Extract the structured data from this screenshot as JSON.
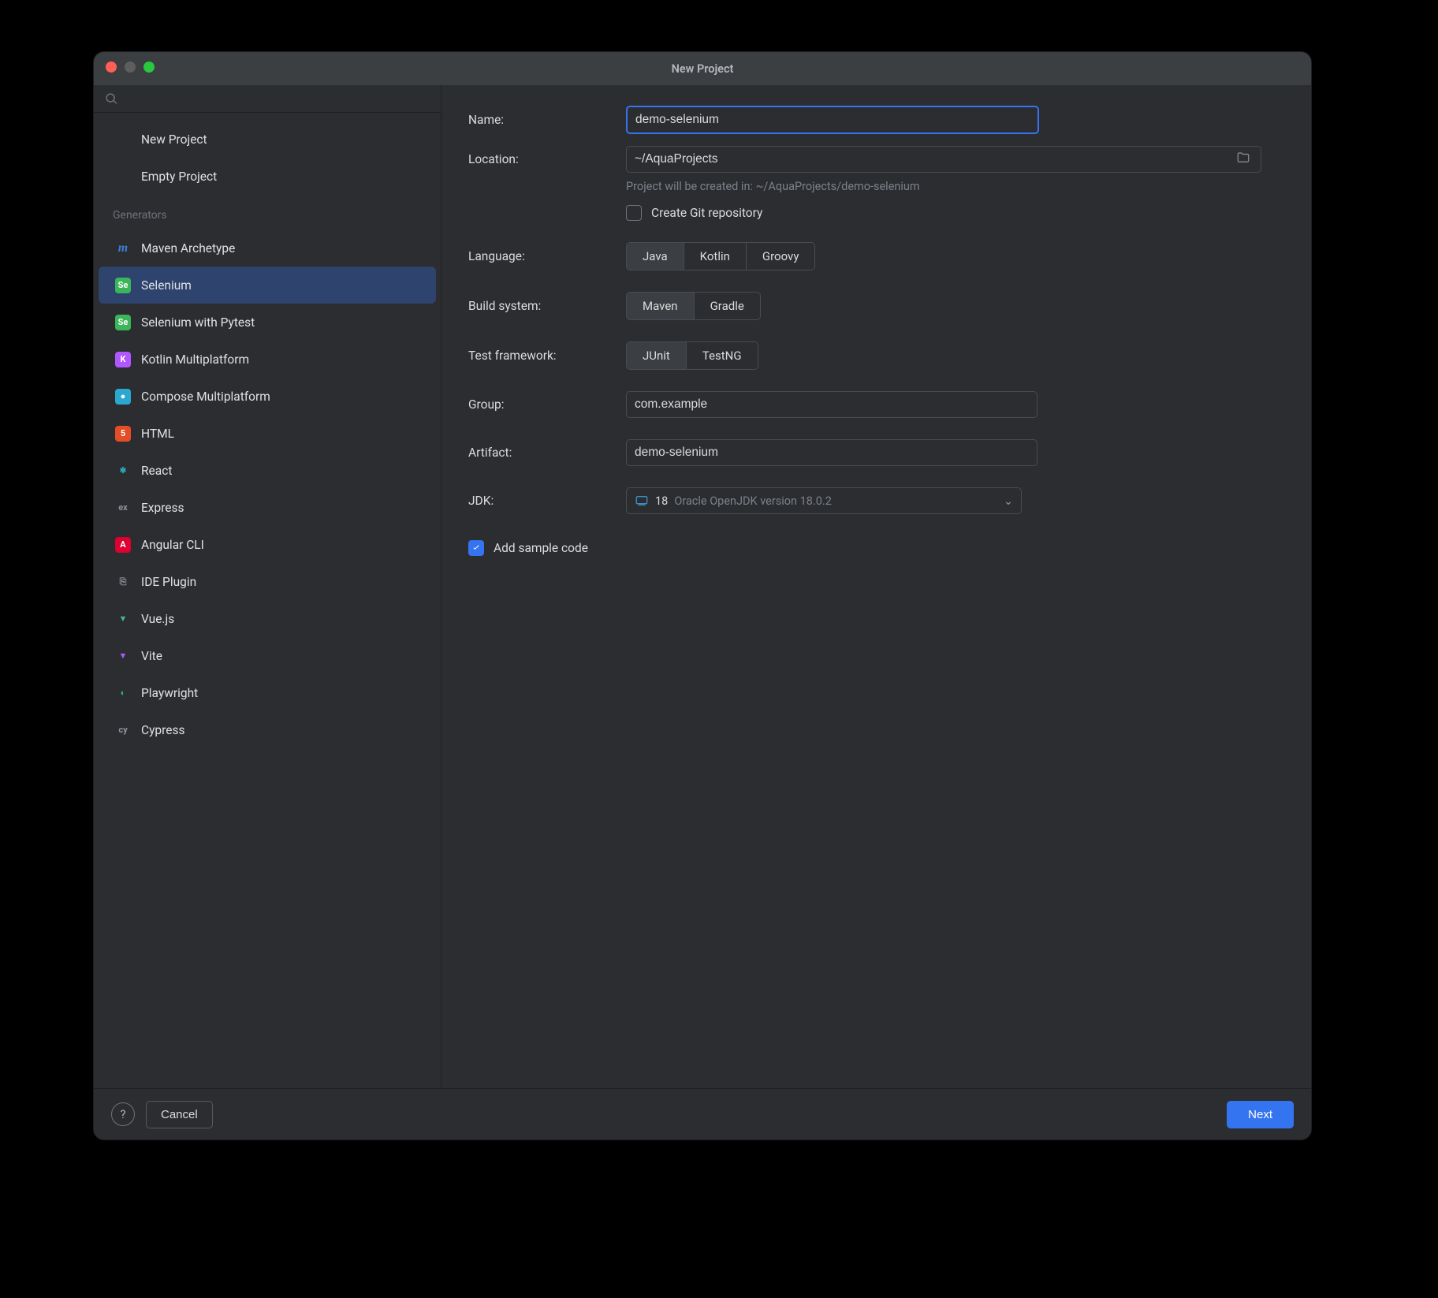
{
  "window": {
    "title": "New Project"
  },
  "sidebar": {
    "top": [
      {
        "label": "New Project"
      },
      {
        "label": "Empty Project"
      }
    ],
    "generators_header": "Generators",
    "generators": [
      {
        "label": "Maven Archetype",
        "icon": "maven"
      },
      {
        "label": "Selenium",
        "icon": "selenium",
        "selected": true
      },
      {
        "label": "Selenium with Pytest",
        "icon": "selenium"
      },
      {
        "label": "Kotlin Multiplatform",
        "icon": "kotlin"
      },
      {
        "label": "Compose Multiplatform",
        "icon": "compose"
      },
      {
        "label": "HTML",
        "icon": "html"
      },
      {
        "label": "React",
        "icon": "react"
      },
      {
        "label": "Express",
        "icon": "express"
      },
      {
        "label": "Angular CLI",
        "icon": "angular"
      },
      {
        "label": "IDE Plugin",
        "icon": "plugin"
      },
      {
        "label": "Vue.js",
        "icon": "vue"
      },
      {
        "label": "Vite",
        "icon": "vite"
      },
      {
        "label": "Playwright",
        "icon": "playwright"
      },
      {
        "label": "Cypress",
        "icon": "cypress"
      }
    ]
  },
  "form": {
    "name_label": "Name:",
    "name_value": "demo-selenium",
    "location_label": "Location:",
    "location_value": "~/AquaProjects",
    "location_hint": "Project will be created in: ~/AquaProjects/demo-selenium",
    "git_checkbox_label": "Create Git repository",
    "git_checked": false,
    "language_label": "Language:",
    "language_options": [
      "Java",
      "Kotlin",
      "Groovy"
    ],
    "language_selected": "Java",
    "build_label": "Build system:",
    "build_options": [
      "Maven",
      "Gradle"
    ],
    "build_selected": "Maven",
    "test_label": "Test framework:",
    "test_options": [
      "JUnit",
      "TestNG"
    ],
    "test_selected": "JUnit",
    "group_label": "Group:",
    "group_value": "com.example",
    "artifact_label": "Artifact:",
    "artifact_value": "demo-selenium",
    "jdk_label": "JDK:",
    "jdk_value": "18",
    "jdk_detail": "Oracle OpenJDK version 18.0.2",
    "sample_label": "Add sample code",
    "sample_checked": true
  },
  "footer": {
    "cancel": "Cancel",
    "next": "Next"
  },
  "icons": {
    "maven": {
      "bg": "transparent",
      "fg": "#3c7fd6",
      "text": "m",
      "italic": true
    },
    "selenium": {
      "bg": "#3bb55a",
      "fg": "#fff",
      "text": "Se"
    },
    "kotlin": {
      "bg": "#b157ff",
      "fg": "#fff",
      "text": "K"
    },
    "compose": {
      "bg": "#2aa8d0",
      "fg": "#fff",
      "text": "●"
    },
    "html": {
      "bg": "#e44d26",
      "fg": "#fff",
      "text": "5"
    },
    "react": {
      "bg": "transparent",
      "fg": "#2ac7e3",
      "text": "⚛"
    },
    "express": {
      "bg": "transparent",
      "fg": "#8e9299",
      "text": "ex"
    },
    "angular": {
      "bg": "#dd0031",
      "fg": "#fff",
      "text": "A"
    },
    "plugin": {
      "bg": "transparent",
      "fg": "#8e9299",
      "text": "⎘"
    },
    "vue": {
      "bg": "transparent",
      "fg": "#42b883",
      "text": "▼"
    },
    "vite": {
      "bg": "transparent",
      "fg": "#b157ff",
      "text": "▼"
    },
    "playwright": {
      "bg": "transparent",
      "fg": "#3bb55a",
      "text": "◐"
    },
    "cypress": {
      "bg": "transparent",
      "fg": "#8e9299",
      "text": "cy"
    }
  }
}
